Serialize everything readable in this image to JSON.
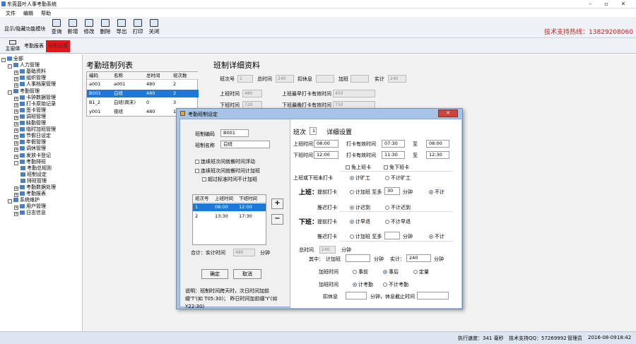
{
  "app": {
    "title": "东莞蓝叶人事考勤系统"
  },
  "menu": [
    "文件",
    "编辑",
    "帮助"
  ],
  "toolbar": {
    "toggle": "显示/隐藏功能模块",
    "query": "查询",
    "add": "新增",
    "edit": "修改",
    "delete": "删除",
    "export": "导出",
    "print": "打印",
    "close": "关闭",
    "hotline": "技术支持热线：13829208060"
  },
  "tabs": {
    "home": "主窗体",
    "report": "考勤报表",
    "shift": "班制设置"
  },
  "tree": [
    {
      "label": "全部",
      "level": 0,
      "exp": "-"
    },
    {
      "label": "人力管理",
      "level": 1,
      "exp": "-"
    },
    {
      "label": "基础资料",
      "level": 2,
      "exp": "+"
    },
    {
      "label": "组织管理",
      "level": 2,
      "exp": "+"
    },
    {
      "label": "人事档案管理",
      "level": 2,
      "exp": "+"
    },
    {
      "label": "考勤管理",
      "level": 1,
      "exp": "-"
    },
    {
      "label": "卡钟数据管理",
      "level": 2,
      "exp": "+"
    },
    {
      "label": "打卡原始记录",
      "level": 2,
      "exp": "+"
    },
    {
      "label": "签卡管理",
      "level": 2,
      "exp": "+"
    },
    {
      "label": "调班管理",
      "level": 2,
      "exp": "+"
    },
    {
      "label": "缺勤管理",
      "level": 2,
      "exp": "+"
    },
    {
      "label": "临时加班管理",
      "level": 2,
      "exp": "+"
    },
    {
      "label": "节假日设定",
      "level": 2,
      "exp": "+"
    },
    {
      "label": "年假管理",
      "level": 2,
      "exp": "+"
    },
    {
      "label": "调休管理",
      "level": 2,
      "exp": "+"
    },
    {
      "label": "发放卡登记",
      "level": 2,
      "exp": "+"
    },
    {
      "label": "考勤排班",
      "level": 2,
      "exp": "-"
    },
    {
      "label": "考勤总规则",
      "level": 3,
      "exp": ""
    },
    {
      "label": "班制设定",
      "level": 3,
      "exp": ""
    },
    {
      "label": "排班管理",
      "level": 3,
      "exp": ""
    },
    {
      "label": "考勤数据处理",
      "level": 2,
      "exp": "+"
    },
    {
      "label": "考勤报表",
      "level": 2,
      "exp": "+"
    },
    {
      "label": "系统维护",
      "level": 1,
      "exp": "-"
    },
    {
      "label": "用户管理",
      "level": 2,
      "exp": "+"
    },
    {
      "label": "日志信息",
      "level": 2,
      "exp": "+"
    }
  ],
  "list": {
    "title": "考勤班制列表",
    "headers": [
      "编码",
      "名称",
      "总时间",
      "班次数"
    ],
    "rows": [
      [
        "a001",
        "a001",
        "480",
        "2"
      ],
      [
        "B001",
        "白班",
        "480",
        "2"
      ],
      [
        "B1_2",
        "白班(周末)",
        "0",
        "3"
      ],
      [
        "y001",
        "夜班",
        "480",
        "1"
      ]
    ]
  },
  "detail": {
    "title": "班制详细资料",
    "shift_no": "班次号",
    "shift_no_val": "1",
    "total_time": "总时间",
    "total_val": "240",
    "deduct": "扣休息",
    "overtime": "加班",
    "actual": "实计",
    "actual_val": "240",
    "on_time": "上班时间",
    "on_val": "480",
    "on_earliest": "上班最早打卡有效时间",
    "on_earliest_val": "450",
    "off_time": "下班时间",
    "off_val": "720",
    "off_latest": "下班最晚打卡有效时间",
    "off_latest_val": "750"
  },
  "dialog": {
    "title": "考勤班制设定",
    "code_label": "班制编码",
    "code": "B001",
    "name_label": "班制名称",
    "name": "白班",
    "chk1": "连续班次间就餐时间浮动",
    "chk2": "连续班次间就餐时间计加班",
    "chk3": "超过标准时间不计加班",
    "inner_headers": [
      "班次号",
      "上班时间",
      "下班时间"
    ],
    "inner_rows": [
      [
        "1",
        "08:00",
        "12:00"
      ],
      [
        "2",
        "13:30",
        "17:30"
      ]
    ],
    "plus": "+",
    "minus": "−",
    "total_label": "合计：实计时间",
    "total_val": "480",
    "minute": "分钟",
    "ok": "确定",
    "cancel": "取消",
    "note": "说明：班制时间跨天时，次日时间加前缀'T'(如  T05:30)；  昨日时间加前缀'Y'(如  Y22:30)",
    "r": {
      "shift": "班次",
      "shift_num": "1",
      "detail": "详细设置",
      "on": "上班时间",
      "on_val": "08:00",
      "off": "下班时间",
      "off_val": "12:00",
      "on_valid": "打卡有效时间",
      "on_valid_from": "07:30",
      "to": "至",
      "on_valid_to": "08:00",
      "off_valid": "打卡有效时间",
      "off_valid_from": "11:30",
      "off_valid_to": "12:30",
      "free_on": "免上班卡",
      "free_off": "免下班卡",
      "miss": "上班或下班未打卡",
      "miss_a": "计旷工",
      "miss_b": "不计旷工",
      "on_hdr": "上班：",
      "early_in": "提前打卡",
      "ot_in": "计加班",
      "ot_in_more": "至多",
      "ot_in_val": "30",
      "min": "分钟",
      "no_count": "不计",
      "late_in": "推迟打卡",
      "late_a": "计迟到",
      "late_b": "不计迟到",
      "off_hdr": "下班：",
      "early_out": "提前打卡",
      "early_a": "计早退",
      "early_b": "不计早退",
      "late_out": "推迟打卡",
      "ot_out": "计加班",
      "ot_out_more": "至多",
      "total": "总时间",
      "total_val": "240",
      "minute": "分钟",
      "among": "其中：",
      "ot": "计加班",
      "actual": "实计：",
      "actual_val": "240",
      "ot_time": "加班时间",
      "before": "事前",
      "after": "事后",
      "fixed": "定量",
      "ot_time2": "加班时间",
      "count_a": "计考勤",
      "count_b": "不计考勤",
      "deduct": "扣休息",
      "rest_deadline": "分钟，休息截止时间"
    }
  },
  "status": {
    "speed": "执行速度：341  毫秒",
    "qq": "技术支持QQ：57269992",
    "user": "管理员",
    "date": "2016-08-09",
    "time": "18:42"
  }
}
